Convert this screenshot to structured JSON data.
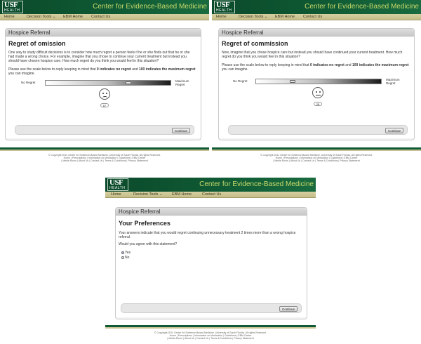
{
  "site": {
    "logo_text": "USF",
    "logo_sub": "HEALTH",
    "title": "Center for Evidence-Based Medicine",
    "nav": [
      "Home",
      "Decision Tools ⌄",
      "EBM Home",
      "Contact Us"
    ]
  },
  "screens": [
    {
      "panel_title": "Hospice Referral",
      "heading": "Regret of omission",
      "paragraph": "One way to study difficult decisions is to consider how much regret a person feels if he or she finds out that he or she had made a wrong choice. For example, imagine that you chose to continue your current treatment but instead you should have chosen hospice care. How much regret do you think you would feel in this situation?",
      "instruction_pre": "Please use the scale below to reply keeping in mind that ",
      "instruction_bold1": "0 indicates no regret",
      "instruction_mid": " and ",
      "instruction_bold2": "100 indicates the maximum regret",
      "instruction_post": " you can imagine.",
      "scale_min_label": "No Regret",
      "scale_max_label": "Maximum Regret",
      "slider_value": 67,
      "value_display": "67",
      "continue_label": "Continue"
    },
    {
      "panel_title": "Hospice Referral",
      "heading": "Regret of commission",
      "paragraph": "Now, imagine that you chose hospice care but instead you should have continued your current treatment. How much regret do you think you would feel in this situation?",
      "instruction_pre": "Please use the scale below to reply keeping in mind that ",
      "instruction_bold1": "0 indicates no regret",
      "instruction_mid": " and ",
      "instruction_bold2": "100 indicates the maximum regret",
      "instruction_post": " you can imagine.",
      "scale_min_label": "No Regret",
      "scale_max_label": "Maximum Regret",
      "slider_value": 28,
      "value_display": "28",
      "continue_label": "Continue"
    },
    {
      "panel_title": "Hospice Referral",
      "heading": "Your Preferences",
      "paragraph": "Your answers indicate that you would regret continuing unnecessary treatment 2 times more than a wrong hospice referral.",
      "question": "Would you agree with this statement?",
      "options": [
        {
          "label": "Yes",
          "selected": true
        },
        {
          "label": "No",
          "selected": false
        }
      ],
      "continue_label": "Continue"
    }
  ],
  "footer": {
    "line1": "© Copyright 2011 Center for Evidence-Based Medicine, University of South Florida. All rights Reserved.",
    "line2": "Home | Prescriptions | Information on Medication | Guidelines | EBM Center",
    "line3": "| Media Room | About Us | Contact Us | Terms & Conditions | Privacy Statement"
  },
  "colors": {
    "brand_green": "#0f5a34",
    "title_yellow": "#c8d96a",
    "nav_tan": "#c4bd88"
  }
}
